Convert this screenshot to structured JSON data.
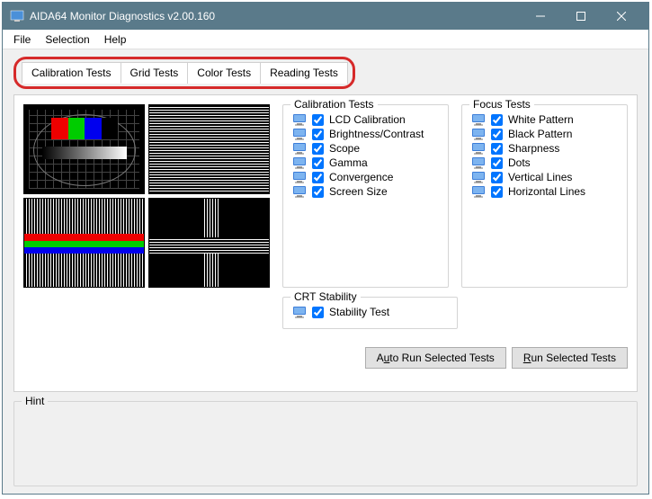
{
  "window": {
    "title": "AIDA64 Monitor Diagnostics v2.00.160"
  },
  "menu": {
    "file": "File",
    "selection": "Selection",
    "help": "Help"
  },
  "tabs": {
    "calibration": "Calibration Tests",
    "grid": "Grid Tests",
    "color": "Color Tests",
    "reading": "Reading Tests"
  },
  "groups": {
    "calibration": {
      "title": "Calibration Tests",
      "items": [
        {
          "label": "LCD Calibration",
          "checked": true
        },
        {
          "label": "Brightness/Contrast",
          "checked": true
        },
        {
          "label": "Scope",
          "checked": true
        },
        {
          "label": "Gamma",
          "checked": true
        },
        {
          "label": "Convergence",
          "checked": true
        },
        {
          "label": "Screen Size",
          "checked": true
        }
      ]
    },
    "focus": {
      "title": "Focus Tests",
      "items": [
        {
          "label": "White Pattern",
          "checked": true
        },
        {
          "label": "Black Pattern",
          "checked": true
        },
        {
          "label": "Sharpness",
          "checked": true
        },
        {
          "label": "Dots",
          "checked": true
        },
        {
          "label": "Vertical Lines",
          "checked": true
        },
        {
          "label": "Horizontal Lines",
          "checked": true
        }
      ]
    },
    "crt": {
      "title": "CRT Stability",
      "items": [
        {
          "label": "Stability Test",
          "checked": true
        }
      ]
    }
  },
  "buttons": {
    "autorun_pre": "A",
    "autorun_u": "u",
    "autorun_post": "to Run Selected Tests",
    "run_u": "R",
    "run_post": "un Selected Tests"
  },
  "hint": {
    "title": "Hint"
  }
}
